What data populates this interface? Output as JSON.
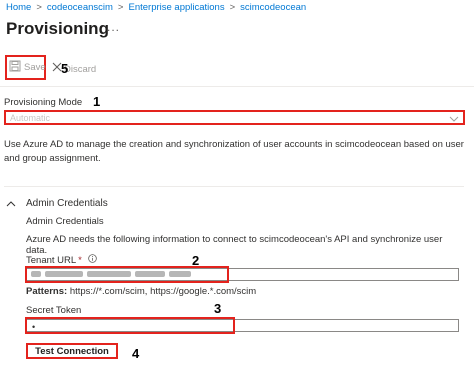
{
  "breadcrumb": {
    "items": [
      "Home",
      "codeoceanscim",
      "Enterprise applications",
      "scimcodeocean"
    ],
    "separator": ">"
  },
  "page": {
    "title": "Provisioning",
    "more_label": "..."
  },
  "toolbar": {
    "save_label": "Save",
    "discard_label": "Discard",
    "save_icon": "save-icon",
    "discard_icon": "close-icon"
  },
  "annotations": [
    "1",
    "2",
    "3",
    "4",
    "5"
  ],
  "provisioning_mode": {
    "label": "Provisioning Mode",
    "value": "Automatic",
    "icon": "chevron-down-icon"
  },
  "description": "Use Azure AD to manage the creation and synchronization of user accounts in scimcodeocean based on user and group assignment.",
  "admin_credentials": {
    "section_label": "Admin Credentials",
    "heading": "Admin Credentials",
    "intro": "Azure AD needs the following information to connect to scimcodeocean's API and synchronize user data.",
    "tenant_url": {
      "label": "Tenant URL",
      "required_mark": "*",
      "info_icon": "info-icon"
    },
    "patterns": {
      "label": "Patterns:",
      "value": "https://*.com/scim, https://google.*.com/scim"
    },
    "secret_token": {
      "label": "Secret Token",
      "value": "•"
    },
    "test_connection_label": "Test Connection"
  },
  "colors": {
    "accent": "#0078d4",
    "annotation_red": "#e3231d",
    "required": "#a4262c"
  }
}
